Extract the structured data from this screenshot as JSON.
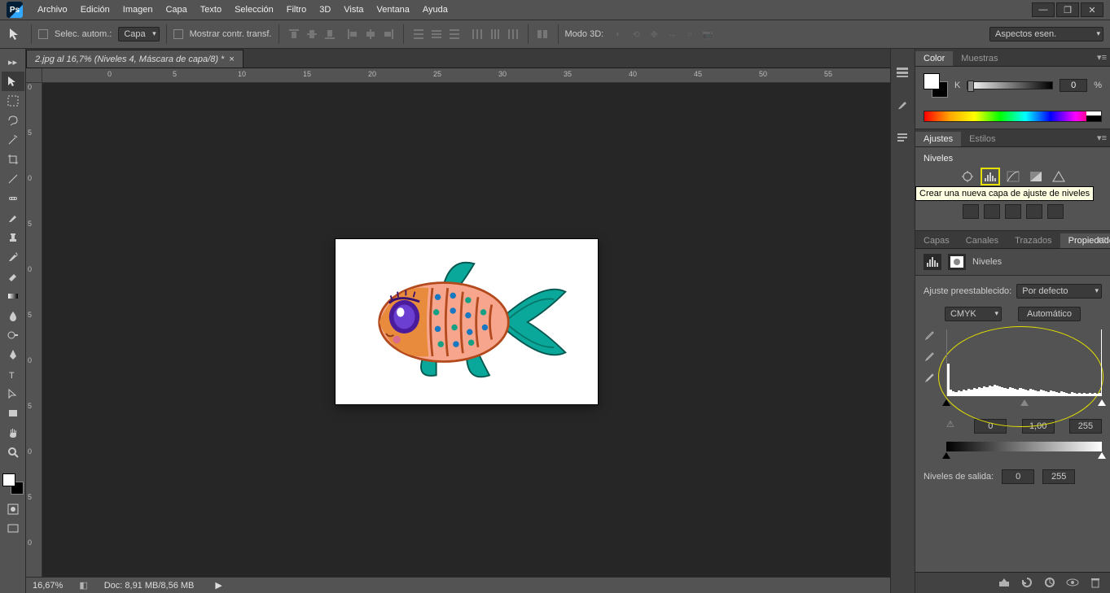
{
  "menu": {
    "items": [
      "Archivo",
      "Edición",
      "Imagen",
      "Capa",
      "Texto",
      "Selección",
      "Filtro",
      "3D",
      "Vista",
      "Ventana",
      "Ayuda"
    ],
    "logo": "Ps"
  },
  "optionsbar": {
    "auto_select_label": "Selec. autom.:",
    "layer_dropdown": "Capa",
    "show_transform_label": "Mostrar contr. transf.",
    "mode3d_label": "Modo 3D:",
    "right_dropdown": "Aspectos esen."
  },
  "document": {
    "tab_title": "2.jpg al 16,7% (Niveles 4, Máscara de capa/8) *",
    "zoom": "16,67%",
    "doc_info": "Doc: 8,91 MB/8,56 MB",
    "ruler_h": [
      "",
      "0",
      "5",
      "10",
      "15",
      "20",
      "25",
      "30",
      "35",
      "40",
      "45",
      "50",
      "55"
    ],
    "ruler_v": [
      "0",
      "5",
      "0",
      "5",
      "0",
      "5",
      "0",
      "5",
      "0",
      "5",
      "0"
    ]
  },
  "panels": {
    "color": {
      "tab_color": "Color",
      "tab_swatches": "Muestras",
      "channel_label": "K",
      "value": "0",
      "unit": "%"
    },
    "ajustes": {
      "tab_ajustes": "Ajustes",
      "tab_estilos": "Estilos",
      "label": "Niveles",
      "tooltip": "Crear una nueva capa de ajuste de niveles"
    },
    "layers_tabs": {
      "capas": "Capas",
      "canales": "Canales",
      "trazados": "Trazados",
      "propiedades": "Propiedades"
    },
    "properties": {
      "title": "Niveles",
      "preset_label": "Ajuste preestablecido:",
      "preset_value": "Por defecto",
      "channel_value": "CMYK",
      "auto_btn": "Automático",
      "in_black": "0",
      "in_gamma": "1,00",
      "in_white": "255",
      "out_label": "Niveles de salida:",
      "out_black": "0",
      "out_white": "255"
    }
  }
}
